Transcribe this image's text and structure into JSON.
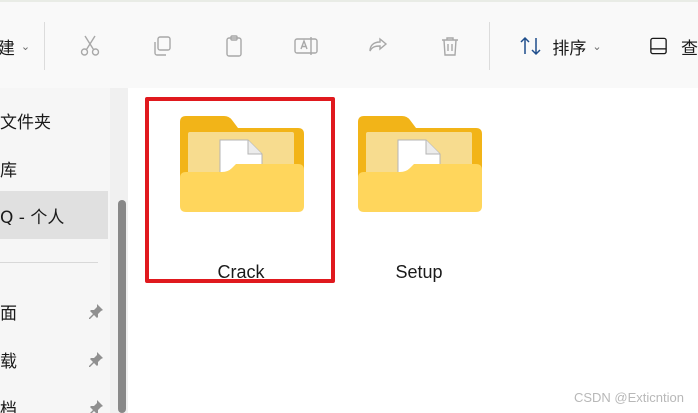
{
  "toolbar": {
    "partial_label": "建",
    "sort_label": "排序",
    "view_label": "查",
    "buttons": [
      {
        "name": "cut",
        "icon": "scissors-icon"
      },
      {
        "name": "copy",
        "icon": "copy-icon"
      },
      {
        "name": "paste",
        "icon": "clipboard-icon"
      },
      {
        "name": "rename",
        "icon": "rename-icon"
      },
      {
        "name": "share",
        "icon": "share-icon"
      },
      {
        "name": "delete",
        "icon": "trash-icon"
      }
    ]
  },
  "sidebar": {
    "items": [
      {
        "label": "文件夹"
      },
      {
        "label": "库"
      },
      {
        "label": "Q - 个人",
        "selected": true
      },
      {
        "label": "面",
        "pinned": true
      },
      {
        "label": "载",
        "pinned": true
      },
      {
        "label": "档",
        "pinned": true
      }
    ]
  },
  "folders": [
    {
      "name": "Crack",
      "highlighted": true
    },
    {
      "name": "Setup"
    }
  ],
  "watermark": "CSDN @Exticntion",
  "colors": {
    "highlight": "#e0191e",
    "folder_back": "#f2b418",
    "folder_front": "#ffd65c"
  }
}
